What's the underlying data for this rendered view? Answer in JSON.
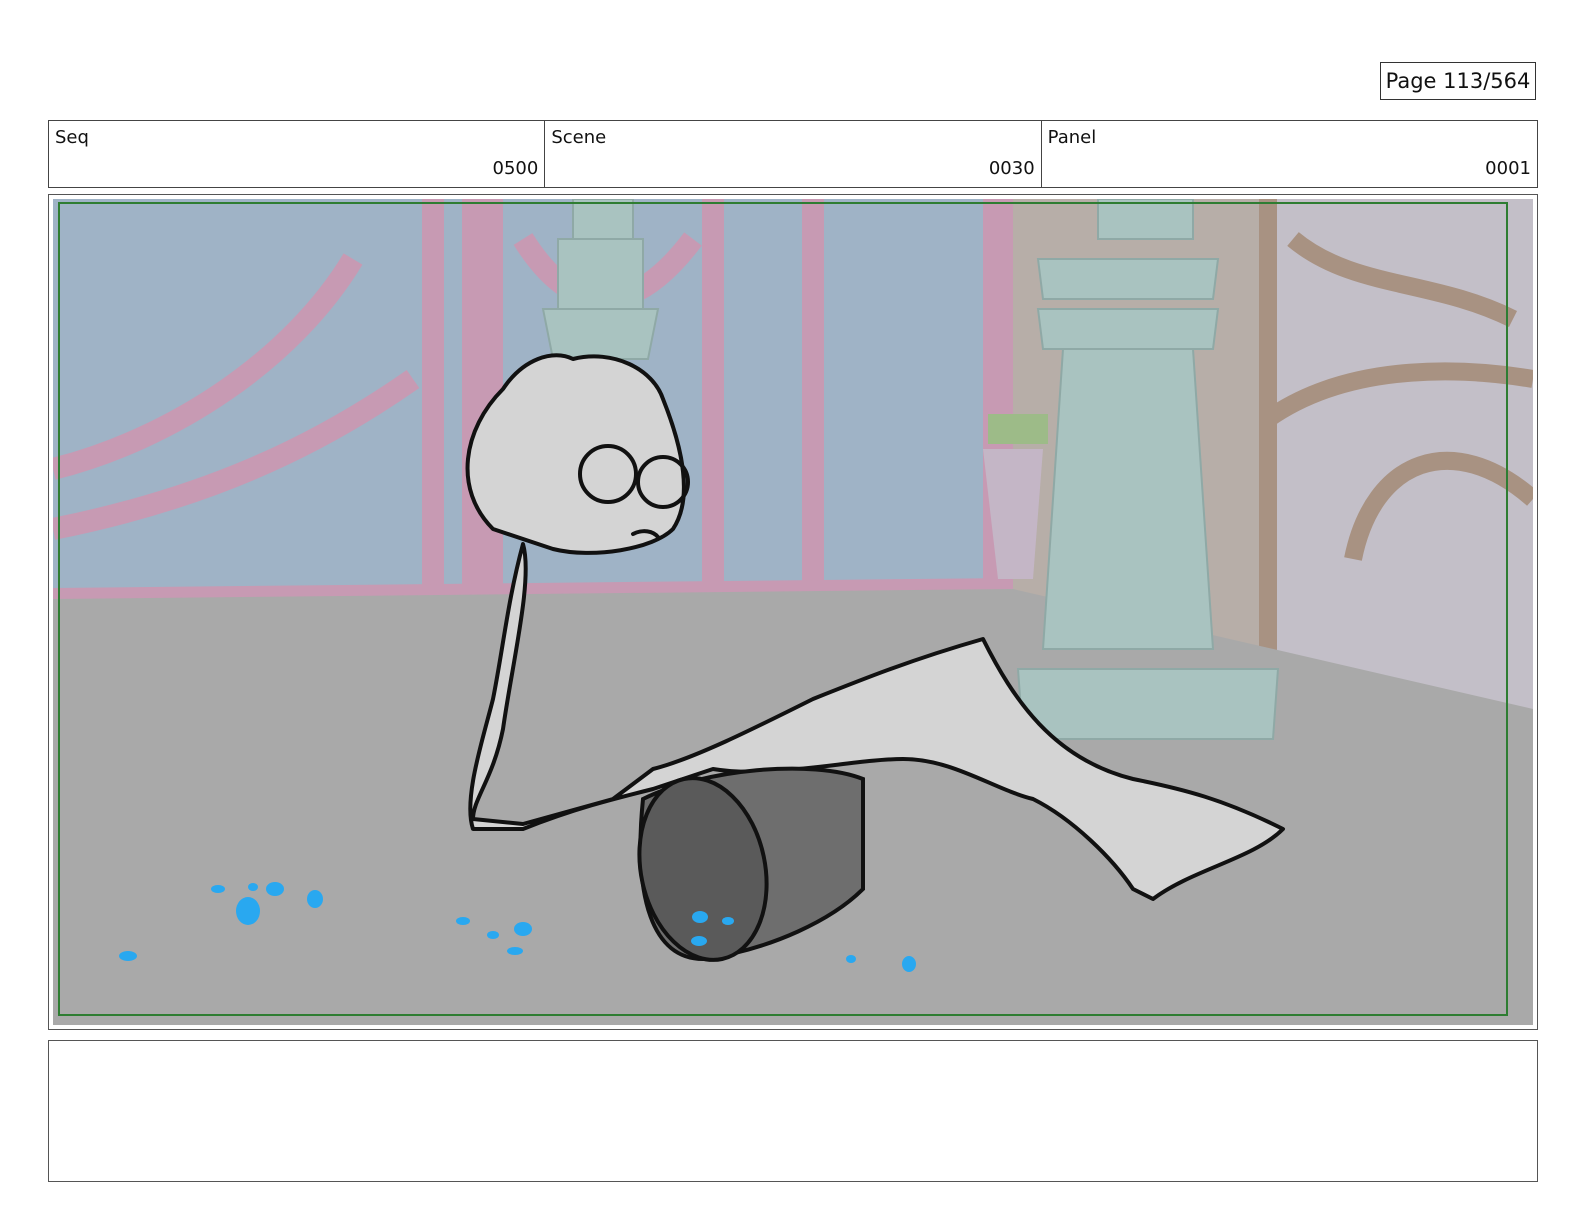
{
  "page": {
    "label": "Page 113/564"
  },
  "header": {
    "seq": {
      "label": "Seq",
      "value": "0500"
    },
    "scene": {
      "label": "Scene",
      "value": "0030"
    },
    "panel": {
      "label": "Panel",
      "value": "0001"
    }
  },
  "panel_image": {
    "description_name": "storyboard-panel-image",
    "colors": {
      "floor": "#a9a9a9",
      "wall_blue": "#9fb3c6",
      "wall_pink": "#c79ab3",
      "pillar": "#a9c3c0",
      "safe_border": "#2e7d32",
      "spill": "#29a8f0",
      "figure_fill": "#d4d4d4",
      "bucket_fill": "#6e6e6e"
    }
  },
  "notes": {
    "text": ""
  }
}
